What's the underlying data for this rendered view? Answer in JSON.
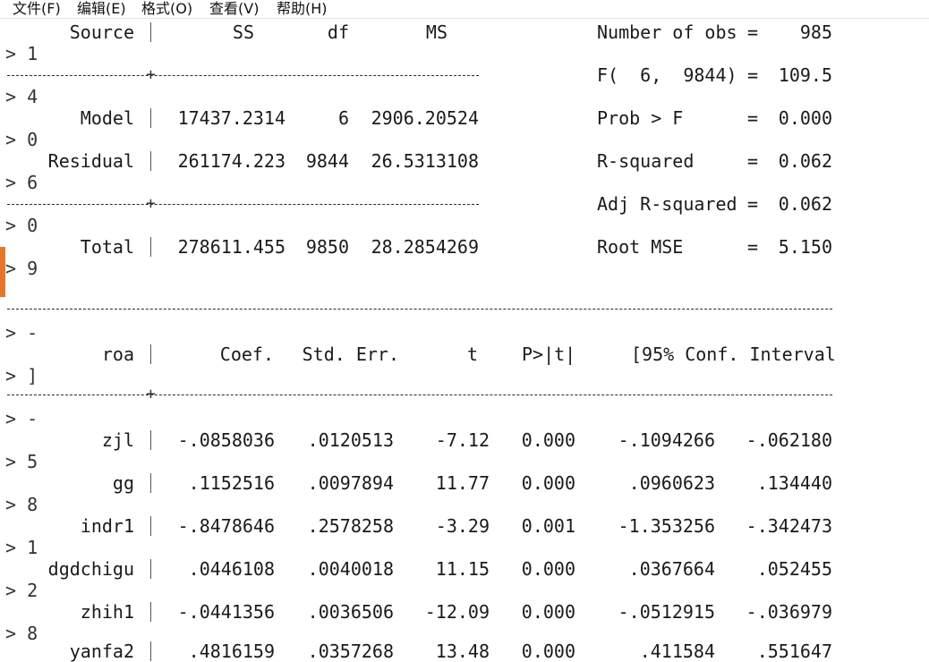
{
  "menu": [
    "文件(F)",
    "编辑(E)",
    "格式(O)",
    "查看(V)",
    "帮助(H)"
  ],
  "anova": {
    "headers": {
      "source": "Source",
      "ss": "SS",
      "df": "df",
      "ms": "MS"
    },
    "rows": [
      {
        "source": "Model",
        "ss": "17437.2314",
        "df": "6",
        "ms": "2906.20524"
      },
      {
        "source": "Residual",
        "ss": "261174.223",
        "df": "9844",
        "ms": "26.5313108"
      },
      {
        "source": "Total",
        "ss": "278611.455",
        "df": "9850",
        "ms": "28.2854269"
      }
    ]
  },
  "stats": [
    {
      "label": "Number of obs",
      "eq": "=",
      "value": "985"
    },
    {
      "label": "F(  6,  9844)",
      "eq": "=",
      "value": "109.5"
    },
    {
      "label": "Prob > F",
      "eq": "=",
      "value": "0.000"
    },
    {
      "label": "R-squared",
      "eq": "=",
      "value": "0.062"
    },
    {
      "label": "Adj R-squared",
      "eq": "=",
      "value": "0.062"
    },
    {
      "label": "Root MSE",
      "eq": "=",
      "value": "5.150"
    }
  ],
  "coef": {
    "headers": {
      "var": "roa",
      "coef": "Coef.",
      "se": "Std. Err.",
      "t": "t",
      "p": "P>|t|",
      "ci": "[95% Conf. Interval"
    },
    "rows": [
      {
        "var": "zjl",
        "coef": "-.0858036",
        "se": ".0120513",
        "t": "-7.12",
        "p": "0.000",
        "lo": "-.1094266",
        "hi": "-.062180"
      },
      {
        "var": "gg",
        "coef": ".1152516",
        "se": ".0097894",
        "t": "11.77",
        "p": "0.000",
        "lo": ".0960623",
        "hi": ".134440"
      },
      {
        "var": "indr1",
        "coef": "-.8478646",
        "se": ".2578258",
        "t": "-3.29",
        "p": "0.001",
        "lo": "-1.353256",
        "hi": "-.342473"
      },
      {
        "var": "dgdchigu",
        "coef": ".0446108",
        "se": ".0040018",
        "t": "11.15",
        "p": "0.000",
        "lo": ".0367664",
        "hi": ".052455"
      },
      {
        "var": "zhih1",
        "coef": "-.0441356",
        "se": ".0036506",
        "t": "-12.09",
        "p": "0.000",
        "lo": "-.0512915",
        "hi": "-.036979"
      },
      {
        "var": "yanfa2",
        "coef": ".4816159",
        "se": ".0357268",
        "t": "13.48",
        "p": "0.000",
        "lo": ".411584",
        "hi": ".551647"
      }
    ]
  },
  "prompts": [
    "> 1",
    "> 4",
    "> 0",
    "> 6",
    "> 0",
    "> 9",
    "> -",
    "> ]",
    "> -",
    "> 5",
    "> 8",
    "> 1",
    "> 2",
    "> 8"
  ],
  "colors": {
    "accent": "#e8742a",
    "text": "#1a1a1a",
    "background": "#ffffff"
  }
}
